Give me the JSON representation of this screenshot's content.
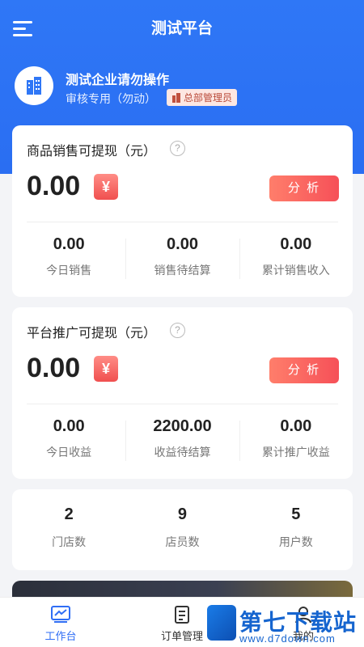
{
  "header": {
    "title": "测试平台"
  },
  "org": {
    "name": "测试企业请勿操作",
    "subtitle": "审核专用（勿动）",
    "role_badge": "总部管理员"
  },
  "sales_card": {
    "title": "商品销售可提现（元）",
    "amount": "0.00",
    "currency_symbol": "¥",
    "analyze_label": "分 析",
    "stats": [
      {
        "value": "0.00",
        "label": "今日销售"
      },
      {
        "value": "0.00",
        "label": "销售待结算"
      },
      {
        "value": "0.00",
        "label": "累计销售收入"
      }
    ]
  },
  "promo_card": {
    "title": "平台推广可提现（元）",
    "amount": "0.00",
    "currency_symbol": "¥",
    "analyze_label": "分 析",
    "stats": [
      {
        "value": "0.00",
        "label": "今日收益"
      },
      {
        "value": "2200.00",
        "label": "收益待结算"
      },
      {
        "value": "0.00",
        "label": "累计推广收益"
      }
    ]
  },
  "counts": [
    {
      "value": "2",
      "label": "门店数"
    },
    {
      "value": "9",
      "label": "店员数"
    },
    {
      "value": "5",
      "label": "用户数"
    }
  ],
  "tabbar": {
    "items": [
      {
        "label": "工作台",
        "icon": "chart-icon",
        "active": true
      },
      {
        "label": "订单管理",
        "icon": "document-icon",
        "active": false
      },
      {
        "label": "我的",
        "icon": "user-icon",
        "active": false
      }
    ]
  },
  "watermark": {
    "title": "第七下载站",
    "url": "www.d7down.com"
  },
  "colors": {
    "primary": "#2f77f6",
    "accent": "#f65058",
    "badge_bg": "#fde7e2"
  }
}
